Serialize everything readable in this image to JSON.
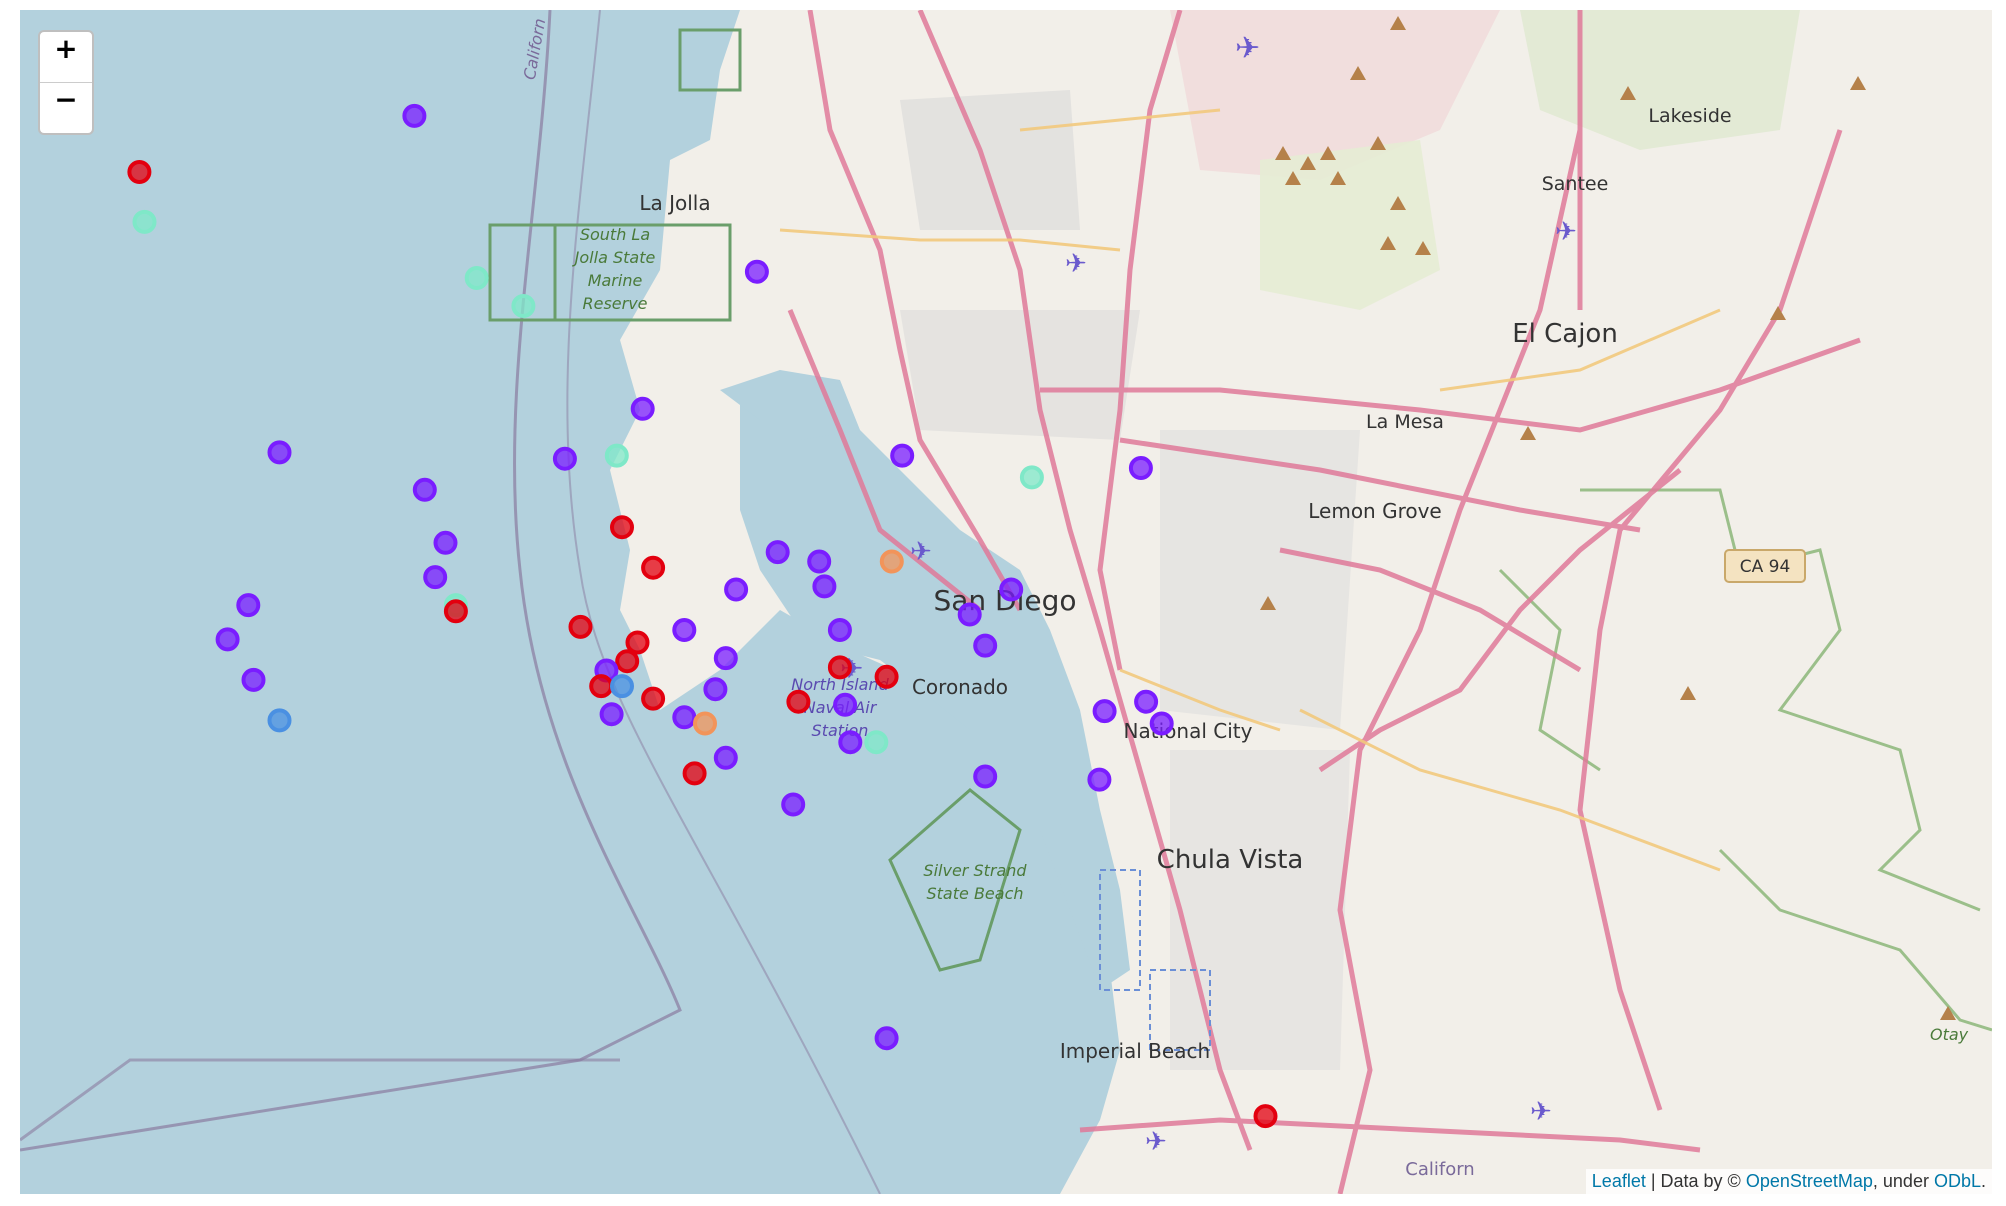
{
  "controls": {
    "zoom_in": "+",
    "zoom_out": "−"
  },
  "attribution": {
    "leaflet": "Leaflet",
    "sep": " | Data by © ",
    "osm": "OpenStreetMap",
    "under": ", under ",
    "odbl": "ODbL",
    "end": "."
  },
  "labels": {
    "la_jolla": "La Jolla",
    "south_la_jolla_1": "South La",
    "south_la_jolla_2": "Jolla State",
    "south_la_jolla_3": "Marine",
    "south_la_jolla_4": "Reserve",
    "santee": "Santee",
    "lakeside": "Lakeside",
    "el_cajon": "El Cajon",
    "la_mesa": "La Mesa",
    "lemon_grove": "Lemon Grove",
    "san_diego": "San Diego",
    "north_island_1": "North Island",
    "north_island_2": "Naval Air",
    "north_island_3": "Station",
    "coronado": "Coronado",
    "national_city": "National City",
    "chula_vista": "Chula Vista",
    "silver_strand_1": "Silver Strand",
    "silver_strand_2": "State Beach",
    "imperial_beach": "Imperial Beach",
    "ca94": "CA 94",
    "otay": "Otay",
    "california_top": "Californ",
    "california_bottom": "Californ"
  },
  "marker_colors": {
    "purple": "#7a1dff",
    "red": "#e3000f",
    "teal": "#7fe8c8",
    "orange": "#f2945a",
    "blue": "#4a90e2"
  },
  "markers": [
    {
      "cat": "red",
      "lat": 32.858,
      "lon": -117.257
    },
    {
      "cat": "teal",
      "lat": 32.842,
      "lon": -117.256
    },
    {
      "cat": "purple",
      "lat": 32.876,
      "lon": -117.204
    },
    {
      "cat": "purple",
      "lat": 32.826,
      "lon": -117.138
    },
    {
      "cat": "teal",
      "lat": 32.824,
      "lon": -117.192
    },
    {
      "cat": "teal",
      "lat": 32.815,
      "lon": -117.183
    },
    {
      "cat": "purple",
      "lat": 32.782,
      "lon": -117.16
    },
    {
      "cat": "purple",
      "lat": 32.768,
      "lon": -117.23
    },
    {
      "cat": "purple",
      "lat": 32.766,
      "lon": -117.175
    },
    {
      "cat": "teal",
      "lat": 32.767,
      "lon": -117.165
    },
    {
      "cat": "purple",
      "lat": 32.756,
      "lon": -117.202
    },
    {
      "cat": "purple",
      "lat": 32.767,
      "lon": -117.11
    },
    {
      "cat": "teal",
      "lat": 32.76,
      "lon": -117.085
    },
    {
      "cat": "purple",
      "lat": 32.763,
      "lon": -117.064
    },
    {
      "cat": "red",
      "lat": 32.744,
      "lon": -117.164
    },
    {
      "cat": "purple",
      "lat": 32.739,
      "lon": -117.198
    },
    {
      "cat": "red",
      "lat": 32.731,
      "lon": -117.158
    },
    {
      "cat": "purple",
      "lat": 32.736,
      "lon": -117.134
    },
    {
      "cat": "purple",
      "lat": 32.733,
      "lon": -117.126
    },
    {
      "cat": "orange",
      "lat": 32.733,
      "lon": -117.112
    },
    {
      "cat": "purple",
      "lat": 32.728,
      "lon": -117.2
    },
    {
      "cat": "purple",
      "lat": 32.724,
      "lon": -117.142
    },
    {
      "cat": "purple",
      "lat": 32.725,
      "lon": -117.125
    },
    {
      "cat": "purple",
      "lat": 32.724,
      "lon": -117.089
    },
    {
      "cat": "purple",
      "lat": 32.719,
      "lon": -117.236
    },
    {
      "cat": "teal",
      "lat": 32.719,
      "lon": -117.196
    },
    {
      "cat": "red",
      "lat": 32.717,
      "lon": -117.196
    },
    {
      "cat": "red",
      "lat": 32.712,
      "lon": -117.172
    },
    {
      "cat": "purple",
      "lat": 32.711,
      "lon": -117.152
    },
    {
      "cat": "purple",
      "lat": 32.711,
      "lon": -117.122
    },
    {
      "cat": "purple",
      "lat": 32.716,
      "lon": -117.097
    },
    {
      "cat": "purple",
      "lat": 32.708,
      "lon": -117.24
    },
    {
      "cat": "red",
      "lat": 32.707,
      "lon": -117.161
    },
    {
      "cat": "purple",
      "lat": 32.706,
      "lon": -117.094
    },
    {
      "cat": "purple",
      "lat": 32.702,
      "lon": -117.144
    },
    {
      "cat": "red",
      "lat": 32.701,
      "lon": -117.163
    },
    {
      "cat": "purple",
      "lat": 32.698,
      "lon": -117.167
    },
    {
      "cat": "red",
      "lat": 32.699,
      "lon": -117.122
    },
    {
      "cat": "red",
      "lat": 32.696,
      "lon": -117.113
    },
    {
      "cat": "purple",
      "lat": 32.695,
      "lon": -117.235
    },
    {
      "cat": "red",
      "lat": 32.693,
      "lon": -117.168
    },
    {
      "cat": "blue",
      "lat": 32.693,
      "lon": -117.164
    },
    {
      "cat": "purple",
      "lat": 32.692,
      "lon": -117.146
    },
    {
      "cat": "red",
      "lat": 32.689,
      "lon": -117.158
    },
    {
      "cat": "red",
      "lat": 32.688,
      "lon": -117.13
    },
    {
      "cat": "purple",
      "lat": 32.687,
      "lon": -117.121
    },
    {
      "cat": "purple",
      "lat": 32.688,
      "lon": -117.063
    },
    {
      "cat": "purple",
      "lat": 32.685,
      "lon": -117.071
    },
    {
      "cat": "purple",
      "lat": 32.684,
      "lon": -117.166
    },
    {
      "cat": "purple",
      "lat": 32.683,
      "lon": -117.152
    },
    {
      "cat": "blue",
      "lat": 32.682,
      "lon": -117.23
    },
    {
      "cat": "orange",
      "lat": 32.681,
      "lon": -117.148
    },
    {
      "cat": "purple",
      "lat": 32.681,
      "lon": -117.06
    },
    {
      "cat": "purple",
      "lat": 32.675,
      "lon": -117.12
    },
    {
      "cat": "teal",
      "lat": 32.675,
      "lon": -117.115
    },
    {
      "cat": "purple",
      "lat": 32.67,
      "lon": -117.144
    },
    {
      "cat": "red",
      "lat": 32.665,
      "lon": -117.15
    },
    {
      "cat": "purple",
      "lat": 32.664,
      "lon": -117.094
    },
    {
      "cat": "purple",
      "lat": 32.663,
      "lon": -117.072
    },
    {
      "cat": "purple",
      "lat": 32.655,
      "lon": -117.131
    },
    {
      "cat": "purple",
      "lat": 32.58,
      "lon": -117.113
    },
    {
      "cat": "red",
      "lat": 32.555,
      "lon": -117.04
    }
  ]
}
